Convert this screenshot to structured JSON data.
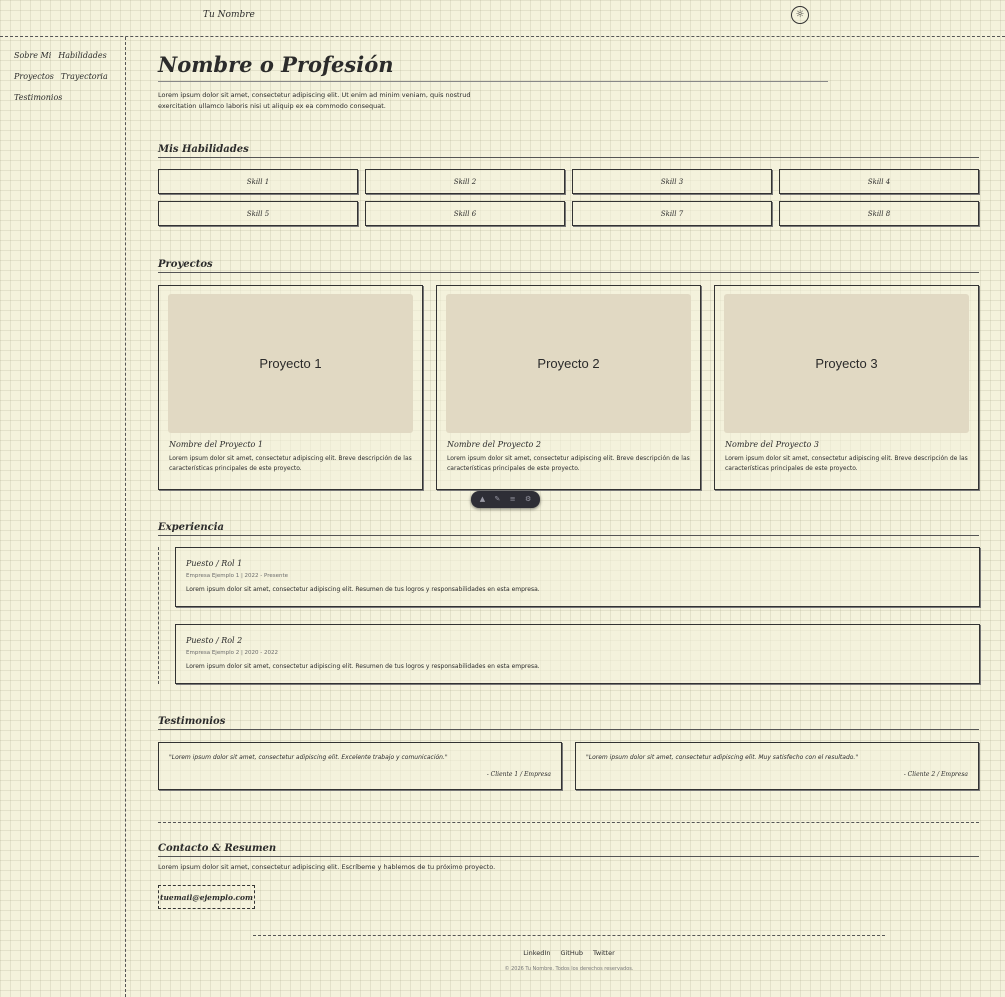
{
  "header": {
    "brand": "Tu Nombre",
    "theme_icon": "sun-icon"
  },
  "sidebar": {
    "items": [
      {
        "label": "Sobre Mi"
      },
      {
        "label": "Habilidades"
      },
      {
        "label": "Proyectos"
      },
      {
        "label": "Trayectoria"
      },
      {
        "label": "Testimonios"
      }
    ]
  },
  "hero": {
    "title": "Nombre o Profesión",
    "text": "Lorem ipsum dolor sit amet, consectetur adipiscing elit. Ut enim ad minim veniam, quis nostrud exercitation ullamco laboris nisi ut aliquip ex ea commodo consequat."
  },
  "skills": {
    "title": "Mis Habilidades",
    "items": [
      "Skill 1",
      "Skill 2",
      "Skill 3",
      "Skill 4",
      "Skill 5",
      "Skill 6",
      "Skill 7",
      "Skill 8"
    ]
  },
  "projects": {
    "title": "Proyectos",
    "items": [
      {
        "image_label": "Proyecto 1",
        "name": "Nombre del Proyecto 1",
        "desc": "Lorem ipsum dolor sit amet, consectetur adipiscing elit. Breve descripción de las características principales de este proyecto."
      },
      {
        "image_label": "Proyecto 2",
        "name": "Nombre del Proyecto 2",
        "desc": "Lorem ipsum dolor sit amet, consectetur adipiscing elit. Breve descripción de las características principales de este proyecto."
      },
      {
        "image_label": "Proyecto 3",
        "name": "Nombre del Proyecto 3",
        "desc": "Lorem ipsum dolor sit amet, consectetur adipiscing elit. Breve descripción de las características principales de este proyecto."
      }
    ]
  },
  "toolbar": {
    "icons": [
      "pointer-icon",
      "edit-icon",
      "list-icon",
      "settings-icon"
    ]
  },
  "experience": {
    "title": "Experiencia",
    "items": [
      {
        "title": "Puesto / Rol 1",
        "meta": "Empresa Ejemplo 1 | 2022 - Presente",
        "desc": "Lorem ipsum dolor sit amet, consectetur adipiscing elit. Resumen de tus logros y responsabilidades en esta empresa."
      },
      {
        "title": "Puesto / Rol 2",
        "meta": "Empresa Ejemplo 2 | 2020 - 2022",
        "desc": "Lorem ipsum dolor sit amet, consectetur adipiscing elit. Resumen de tus logros y responsabilidades en esta empresa."
      }
    ]
  },
  "testimonials": {
    "title": "Testimonios",
    "items": [
      {
        "quote": "\"Lorem ipsum dolor sit amet, consectetur adipiscing elit. Excelente trabajo y comunicación.\"",
        "author": "- Cliente 1 / Empresa"
      },
      {
        "quote": "\"Lorem ipsum dolor sit amet, consectetur adipiscing elit. Muy satisfecho con el resultado.\"",
        "author": "- Cliente 2 / Empresa"
      }
    ]
  },
  "contact": {
    "title": "Contacto & Resumen",
    "text": "Lorem ipsum dolor sit amet, consectetur adipiscing elit. Escríbeme y hablemos de tu próximo proyecto.",
    "email": "tuemail@ejemplo.com"
  },
  "footer": {
    "links": [
      "LinkedIn",
      "GitHub",
      "Twitter"
    ],
    "copyright": "© 2026 Tu Nombre. Todos los derechos reservados."
  }
}
